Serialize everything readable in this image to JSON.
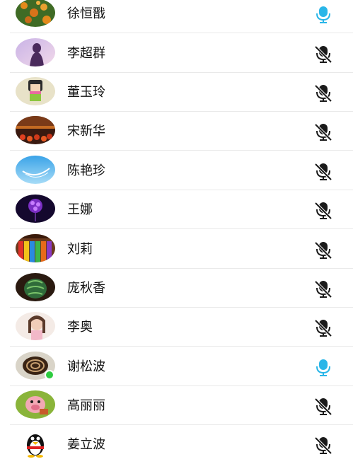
{
  "contacts": [
    {
      "name": "徐恒戬",
      "mic": "mic-active-icon",
      "avatar": "orange-tree-avatar"
    },
    {
      "name": "李超群",
      "mic": "mic-muted-icon",
      "avatar": "purple-silhouette-avatar"
    },
    {
      "name": "董玉玲",
      "mic": "mic-muted-icon",
      "avatar": "cartoon-girl-avatar"
    },
    {
      "name": "宋新华",
      "mic": "mic-muted-icon",
      "avatar": "sunset-fruit-avatar"
    },
    {
      "name": "陈艳珍",
      "mic": "mic-muted-icon",
      "avatar": "blue-sky-avatar"
    },
    {
      "name": "王娜",
      "mic": "mic-muted-icon",
      "avatar": "purple-flowers-avatar"
    },
    {
      "name": " 刘莉",
      "mic": "mic-muted-icon",
      "avatar": "colored-pencils-avatar"
    },
    {
      "name": "庞秋香",
      "mic": "mic-muted-icon",
      "avatar": "watermelon-avatar"
    },
    {
      "name": "李奥",
      "mic": "mic-muted-icon",
      "avatar": "girl-photo-avatar"
    },
    {
      "name": "谢松波",
      "mic": "mic-active-icon",
      "avatar": "coffee-cup-avatar"
    },
    {
      "name": "高丽丽",
      "mic": "mic-muted-icon",
      "avatar": "cartoon-pig-avatar"
    },
    {
      "name": "姜立波",
      "mic": "mic-muted-icon",
      "avatar": "penguin-avatar"
    }
  ],
  "colors": {
    "mic_active": "#29b6e8",
    "mic_muted": "#1a1a1a",
    "divider": "#e9e9e9",
    "online_badge": "#2ecc40"
  }
}
